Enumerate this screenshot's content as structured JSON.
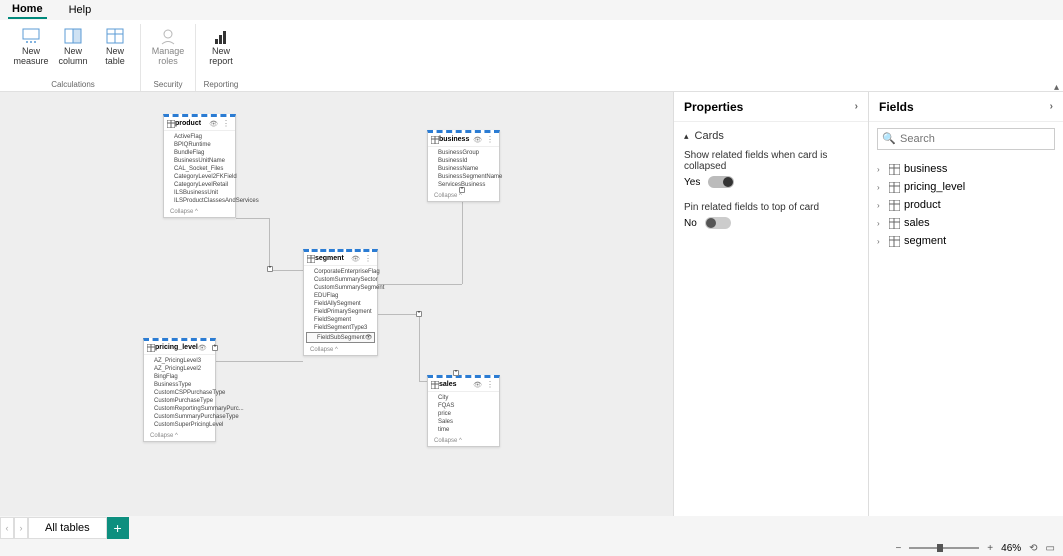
{
  "menu": {
    "home": "Home",
    "help": "Help"
  },
  "ribbon": {
    "new_measure": "New\nmeasure",
    "new_column": "New\ncolumn",
    "new_table": "New\ntable",
    "manage_roles": "Manage\nroles",
    "new_report": "New\nreport",
    "group_calc": "Calculations",
    "group_security": "Security",
    "group_reporting": "Reporting"
  },
  "cards": {
    "product": {
      "title": "product",
      "fields": [
        "ActiveFlag",
        "BPIQRuntime",
        "BundleFlag",
        "BusinessUnitName",
        "CAL_Socket_Files",
        "CategoryLevel2FKField",
        "CategoryLevelRetail",
        "ILSBusinessUnit",
        "ILSProductClassesAndServices"
      ],
      "collapse": "Collapse ^"
    },
    "business": {
      "title": "business",
      "fields": [
        "BusinessGroup",
        "BusinessId",
        "BusinessName",
        "BusinessSegmentName",
        "ServicesBusiness"
      ],
      "collapse": "Collapse ^"
    },
    "segment": {
      "title": "segment",
      "fields": [
        "CorporateEnterpriseFlag",
        "CustomSummarySector",
        "CustomSummarySegment",
        "EDUFlag",
        "FieldAllySegment",
        "FieldPrimarySegment",
        "FieldSegment",
        "FieldSegmentType3",
        "FieldSubSegment"
      ],
      "collapse": "Collapse ^"
    },
    "pricing_level": {
      "title": "pricing_level",
      "fields": [
        "AZ_PricingLevel3",
        "AZ_PricingLevel2",
        "BingFlag",
        "BusinessType",
        "CustomCSPPurchaseType",
        "CustomPurchaseType",
        "CustomReportingSummaryPurc...",
        "CustomSummaryPurchaseType",
        "CustomSuperPricingLevel"
      ],
      "collapse": "Collapse ^"
    },
    "sales": {
      "title": "sales",
      "fields": [
        "City",
        "FQAS",
        "price",
        "Sales",
        "time"
      ],
      "collapse": "Collapse ^"
    }
  },
  "properties": {
    "title": "Properties",
    "section": "Cards",
    "opt1_label": "Show related fields when card is collapsed",
    "opt1_value": "Yes",
    "opt2_label": "Pin related fields to top of card",
    "opt2_value": "No"
  },
  "fields_panel": {
    "title": "Fields",
    "placeholder": "Search",
    "items": [
      "business",
      "pricing_level",
      "product",
      "sales",
      "segment"
    ]
  },
  "tabs": {
    "all": "All tables"
  },
  "status": {
    "zoom": "46%"
  }
}
